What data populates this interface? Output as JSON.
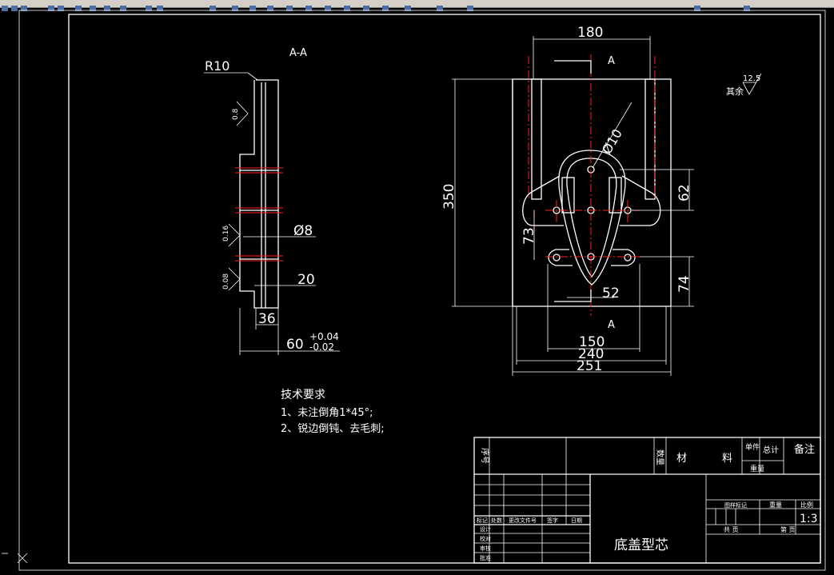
{
  "toolbar": {
    "icons": [
      "new-icon",
      "open-icon",
      "save-icon",
      "print-icon",
      "preview-icon",
      "cut-icon",
      "copy-icon",
      "paste-icon",
      "match-icon",
      "undo-icon",
      "redo-icon",
      "pan-icon",
      "zoom-realtime-icon",
      "zoom-window-icon",
      "zoom-previous-icon",
      "properties-icon",
      "design-center-icon",
      "tool-palette-icon",
      "sheet-set-icon",
      "markup-icon",
      "calculator-icon",
      "help-icon",
      "layer-icon",
      "layer-state-icon",
      "color-icon",
      "linetype-icon"
    ]
  },
  "section_view": {
    "title": "A-A",
    "dims": {
      "r10": "R10",
      "d8": "Ø8",
      "d20": "20",
      "d36": "36",
      "d60": "60",
      "tol_upper": "+0.04",
      "tol_lower": "-0.02"
    },
    "roughness": [
      "0.8",
      "0.16",
      "0.08"
    ]
  },
  "plan_view": {
    "section_label_top": "A",
    "section_label_bottom": "A",
    "dims": {
      "d180": "180",
      "d350": "350",
      "d10": "Ø10",
      "d62": "62",
      "d73": "73",
      "d74": "74",
      "d52": "52",
      "d150": "150",
      "d240": "240",
      "d251": "251"
    }
  },
  "roughness_note": {
    "label": "其余",
    "value": "12.5"
  },
  "notes": {
    "title": "技术要求",
    "line1": "1、未注倒角1*45°;",
    "line2": "2、锐边倒钝、去毛刺;"
  },
  "title_block": {
    "seq": "序号",
    "qty": "数量",
    "material_1": "材",
    "material_2": "料",
    "unit": "单件",
    "total": "总计",
    "weight": "重量",
    "remarks": "备注",
    "mark": "标记",
    "count": "处数",
    "doc_no": "更改文件号",
    "signature": "签字",
    "date": "日期",
    "design": "设计",
    "check": "校对",
    "review": "审核",
    "approve": "批准",
    "stage_mark": "图样标记",
    "mass": "重量",
    "scale": "比例",
    "scale_value": "1:3",
    "total_sheets": "共 页",
    "sheet_no": "第 页",
    "drawing_name": "底盖型芯"
  }
}
